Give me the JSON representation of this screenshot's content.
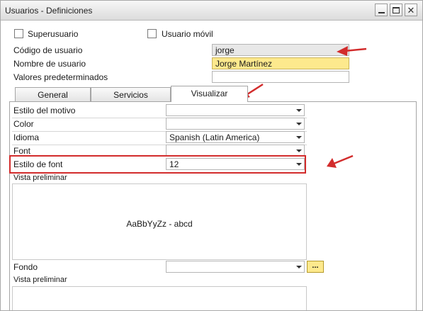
{
  "window": {
    "title": "Usuarios - Definiciones",
    "buttons": {
      "minimize": "minimize-icon",
      "maximize": "maximize-icon",
      "close": "close-icon"
    }
  },
  "header": {
    "superuser_label": "Superusuario",
    "mobile_user_label": "Usuario móvil",
    "user_code_label": "Código de usuario",
    "user_code_value": "jorge",
    "user_name_label": "Nombre de usuario",
    "user_name_value": "Jorge Martínez",
    "defaults_label": "Valores predeterminados",
    "defaults_value": ""
  },
  "tabs": [
    {
      "label": "General"
    },
    {
      "label": "Servicios"
    },
    {
      "label": "Visualizar",
      "active": true
    }
  ],
  "display": {
    "theme_label": "Estilo del motivo",
    "theme_value": "",
    "color_label": "Color",
    "color_value": "",
    "language_label": "Idioma",
    "language_value": "Spanish (Latin America)",
    "font_label": "Font",
    "font_value": "",
    "font_size_label": "Estilo de font",
    "font_size_value": "12",
    "preview_label": "Vista preliminar",
    "preview_text": "AaBbYyZz - abcd",
    "background_label": "Fondo",
    "background_value": "",
    "browse_label": "...",
    "preview2_label": "Vista preliminar"
  },
  "colors": {
    "highlight_field": "#fde98d",
    "annotation_red": "#d22c2c"
  }
}
